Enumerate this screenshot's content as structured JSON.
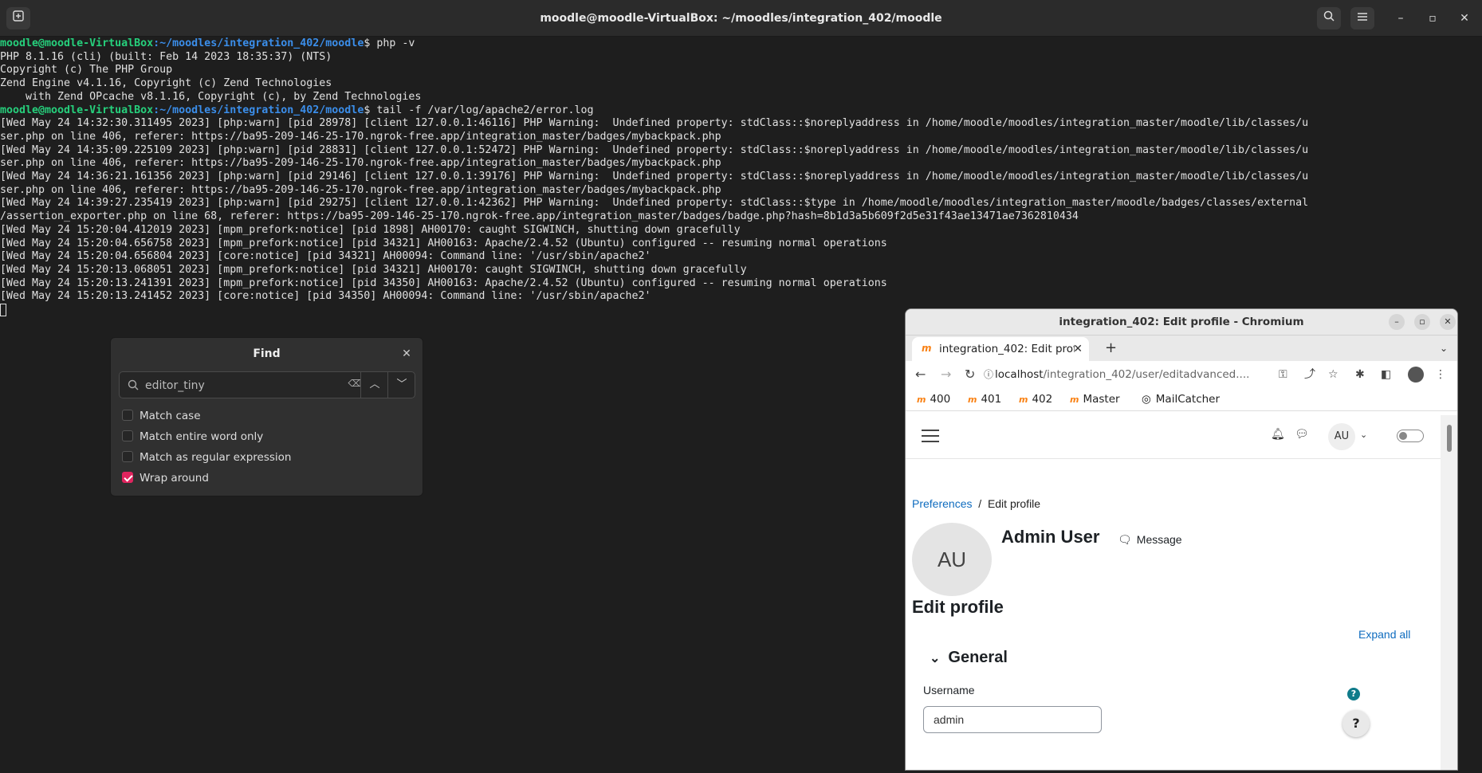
{
  "terminal": {
    "title": "moodle@moodle-VirtualBox: ~/moodles/integration_402/moodle",
    "prompt_user": "moodle@moodle-VirtualBox",
    "prompt_path": ":~/moodles/integration_402/moodle",
    "cmd1": "$ php -v",
    "php_lines": [
      "PHP 8.1.16 (cli) (built: Feb 14 2023 18:35:37) (NTS)",
      "Copyright (c) The PHP Group",
      "Zend Engine v4.1.16, Copyright (c) Zend Technologies",
      "    with Zend OPcache v8.1.16, Copyright (c), by Zend Technologies"
    ],
    "cmd2": "$ tail -f /var/log/apache2/error.log",
    "log_lines": [
      "[Wed May 24 14:32:30.311495 2023] [php:warn] [pid 28978] [client 127.0.0.1:46116] PHP Warning:  Undefined property: stdClass::$noreplyaddress in /home/moodle/moodles/integration_master/moodle/lib/classes/u",
      "ser.php on line 406, referer: https://ba95-209-146-25-170.ngrok-free.app/integration_master/badges/mybackpack.php",
      "[Wed May 24 14:35:09.225109 2023] [php:warn] [pid 28831] [client 127.0.0.1:52472] PHP Warning:  Undefined property: stdClass::$noreplyaddress in /home/moodle/moodles/integration_master/moodle/lib/classes/u",
      "ser.php on line 406, referer: https://ba95-209-146-25-170.ngrok-free.app/integration_master/badges/mybackpack.php",
      "[Wed May 24 14:36:21.161356 2023] [php:warn] [pid 29146] [client 127.0.0.1:39176] PHP Warning:  Undefined property: stdClass::$noreplyaddress in /home/moodle/moodles/integration_master/moodle/lib/classes/u",
      "ser.php on line 406, referer: https://ba95-209-146-25-170.ngrok-free.app/integration_master/badges/mybackpack.php",
      "[Wed May 24 14:39:27.235419 2023] [php:warn] [pid 29275] [client 127.0.0.1:42362] PHP Warning:  Undefined property: stdClass::$type in /home/moodle/moodles/integration_master/moodle/badges/classes/external",
      "/assertion_exporter.php on line 68, referer: https://ba95-209-146-25-170.ngrok-free.app/integration_master/badges/badge.php?hash=8b1d3a5b609f2d5e31f43ae13471ae7362810434",
      "[Wed May 24 15:20:04.412019 2023] [mpm_prefork:notice] [pid 1898] AH00170: caught SIGWINCH, shutting down gracefully",
      "[Wed May 24 15:20:04.656758 2023] [mpm_prefork:notice] [pid 34321] AH00163: Apache/2.4.52 (Ubuntu) configured -- resuming normal operations",
      "[Wed May 24 15:20:04.656804 2023] [core:notice] [pid 34321] AH00094: Command line: '/usr/sbin/apache2'",
      "[Wed May 24 15:20:13.068051 2023] [mpm_prefork:notice] [pid 34321] AH00170: caught SIGWINCH, shutting down gracefully",
      "[Wed May 24 15:20:13.241391 2023] [mpm_prefork:notice] [pid 34350] AH00163: Apache/2.4.52 (Ubuntu) configured -- resuming normal operations",
      "[Wed May 24 15:20:13.241452 2023] [core:notice] [pid 34350] AH00094: Command line: '/usr/sbin/apache2'"
    ]
  },
  "find": {
    "title": "Find",
    "query": "editor_tiny",
    "options": {
      "match_case": "Match case",
      "match_word": "Match entire word only",
      "match_regex": "Match as regular expression",
      "wrap_around": "Wrap around"
    }
  },
  "browser": {
    "title": "integration_402: Edit profile - Chromium",
    "tab_label": "integration_402: Edit profile",
    "url_host": "localhost",
    "url_path": "/integration_402/user/editadvanced....",
    "bookmarks": [
      "400",
      "401",
      "402",
      "Master",
      "MailCatcher"
    ]
  },
  "moodle": {
    "nav_avatar": "AU",
    "breadcrumb_preferences": "Preferences",
    "breadcrumb_sep": "/",
    "breadcrumb_current": "Edit profile",
    "avatar_initials": "AU",
    "user_name": "Admin User",
    "message_label": "Message",
    "heading": "Edit profile",
    "expand_all": "Expand all",
    "section": "General",
    "username_label": "Username",
    "username_value": "admin",
    "help_small": "?",
    "help_big": "?"
  },
  "colors": {
    "terminal_bg": "#1e1e1e",
    "prompt_user": "#26d07c",
    "prompt_path": "#3b8eea",
    "checkbox_on": "#e0245e",
    "moodle_link": "#0f6cbf",
    "moodle_accent": "#f98012"
  }
}
